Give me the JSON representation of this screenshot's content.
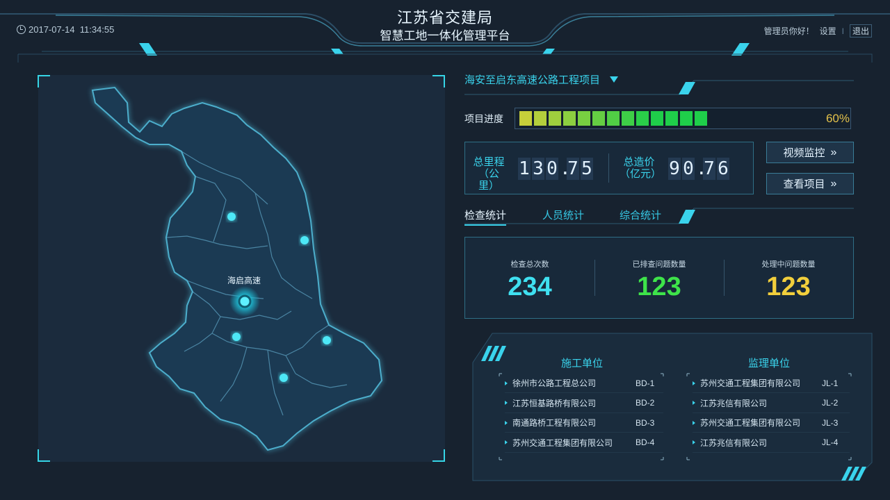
{
  "header": {
    "title_line1": "江苏省交建局",
    "title_line2": "智慧工地一体化管理平台",
    "datetime": "2017-07-14  11:34:55",
    "greeting": "管理员你好！",
    "settings_label": "设置",
    "separator": "I",
    "logout_label": "退出"
  },
  "map": {
    "marker_label": "海启高速"
  },
  "project": {
    "name": "海安至启东高速公路工程项目",
    "progress_label": "项目进度",
    "progress_percent": 60,
    "progress_text": "60%"
  },
  "stats": {
    "mileage_label_1": "总里程",
    "mileage_label_2": "（公里）",
    "mileage_value": "130.75",
    "cost_label_1": "总造价",
    "cost_label_2": "（亿元）",
    "cost_value": "90.76"
  },
  "buttons": {
    "video": "视频监控",
    "view_project": "查看项目"
  },
  "tabs": [
    {
      "label": "检查统计",
      "active": true
    },
    {
      "label": "人员统计",
      "active": false
    },
    {
      "label": "综合统计",
      "active": false
    }
  ],
  "inspection": [
    {
      "label": "检查总次数",
      "value": "234",
      "color": "#3fe0f0"
    },
    {
      "label": "已排查问题数量",
      "value": "123",
      "color": "#3ee34a"
    },
    {
      "label": "处理中问题数量",
      "value": "123",
      "color": "#f2cf3c"
    }
  ],
  "construction_units": {
    "title": "施工单位",
    "items": [
      {
        "name": "徐州市公路工程总公司",
        "code": "BD-1"
      },
      {
        "name": "江苏恒基路桥有限公司",
        "code": "BD-2"
      },
      {
        "name": "南通路桥工程有限公司",
        "code": "BD-3"
      },
      {
        "name": "苏州交通工程集团有限公司",
        "code": "BD-4"
      }
    ]
  },
  "supervision_units": {
    "title": "监理单位",
    "items": [
      {
        "name": "苏州交通工程集团有限公司",
        "code": "JL-1"
      },
      {
        "name": "江苏兆信有限公司",
        "code": "JL-2"
      },
      {
        "name": "苏州交通工程集团有限公司",
        "code": "JL-3"
      },
      {
        "name": "江苏兆信有限公司",
        "code": "JL-4"
      }
    ]
  },
  "colors": {
    "accent": "#3ad3ec",
    "progress_start": "#c6cf3a",
    "progress_end": "#1fce4a",
    "progress_text": "#e3c14a"
  }
}
